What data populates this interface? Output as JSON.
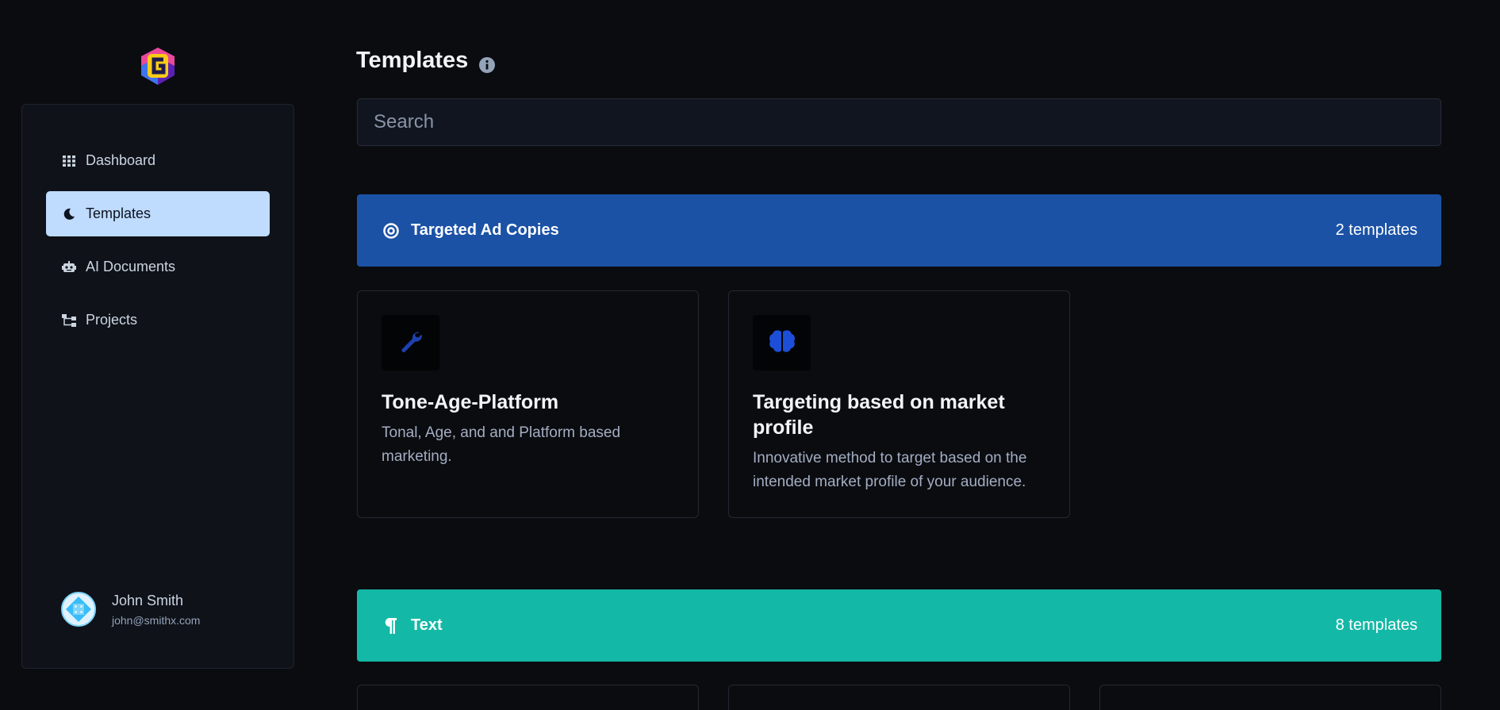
{
  "sidebar": {
    "items": [
      {
        "label": "Dashboard",
        "icon": "grid-icon"
      },
      {
        "label": "Templates",
        "icon": "moon-icon"
      },
      {
        "label": "AI Documents",
        "icon": "robot-icon"
      },
      {
        "label": "Projects",
        "icon": "sitemap-icon"
      }
    ],
    "user": {
      "name": "John Smith",
      "email": "john@smithx.com"
    }
  },
  "page": {
    "title": "Templates",
    "info_icon": "info-icon"
  },
  "search": {
    "placeholder": "Search"
  },
  "categories": [
    {
      "name": "Targeted Ad Copies",
      "count": "2 templates",
      "icon": "target-icon",
      "color": "#1b52a6",
      "templates": [
        {
          "title": "Tone-Age-Platform",
          "description": "Tonal, Age, and and Platform based marketing.",
          "icon": "wrench-icon"
        },
        {
          "title": "Targeting based on market profile",
          "description": "Innovative method to target based on the intended market profile of your audience.",
          "icon": "brain-icon"
        }
      ]
    },
    {
      "name": "Text",
      "count": "8 templates",
      "icon": "paragraph-icon",
      "color": "#14b8a6"
    }
  ],
  "colors": {
    "background": "#0b0c10",
    "sidebar_active": "#bfdbfe",
    "icon_accent": "#1d4ed8"
  }
}
